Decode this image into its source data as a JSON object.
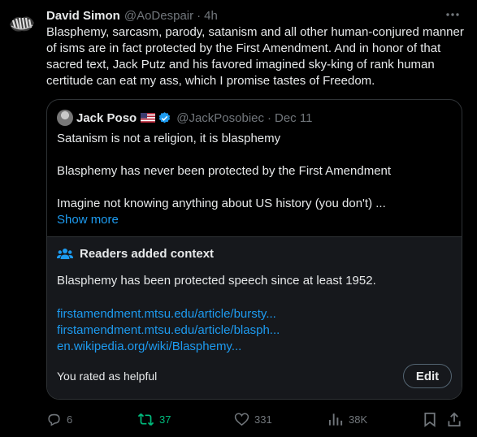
{
  "post": {
    "author_name": "David Simon",
    "author_handle": "@AoDespair",
    "separator": "·",
    "time": "4h",
    "text": "Blasphemy, sarcasm, parody, satanism and all other human-conjured manner of isms are in fact protected by the First  Amendment. And in honor of that sacred text, Jack Putz and his favored imagined sky-king of rank human certitude can eat my ass, which I promise tastes of Freedom."
  },
  "quoted": {
    "author_name": "Jack Poso",
    "author_handle": "@JackPosobiec",
    "separator": "·",
    "date": "Dec 11",
    "lines": [
      "Satanism is not a religion, it is blasphemy",
      "Blasphemy has never been protected by the First Amendment",
      "Imagine not knowing anything about US history (you don't) ..."
    ],
    "show_more": "Show more"
  },
  "community_note": {
    "title": "Readers added context",
    "text": "Blasphemy has been protected speech since at least 1952.",
    "links": [
      "firstamendment.mtsu.edu/article/bursty...",
      "firstamendment.mtsu.edu/article/blasph...",
      "en.wikipedia.org/wiki/Blasphemy..."
    ],
    "rated": "You rated as helpful",
    "edit_label": "Edit"
  },
  "actions": {
    "replies": "6",
    "reposts": "37",
    "likes": "331",
    "views": "38K"
  },
  "colors": {
    "background": "#000000",
    "text": "#e7e9ea",
    "muted": "#71767b",
    "link": "#1d9bf0",
    "repost_active": "#00ba7c",
    "border": "#2f3336"
  }
}
